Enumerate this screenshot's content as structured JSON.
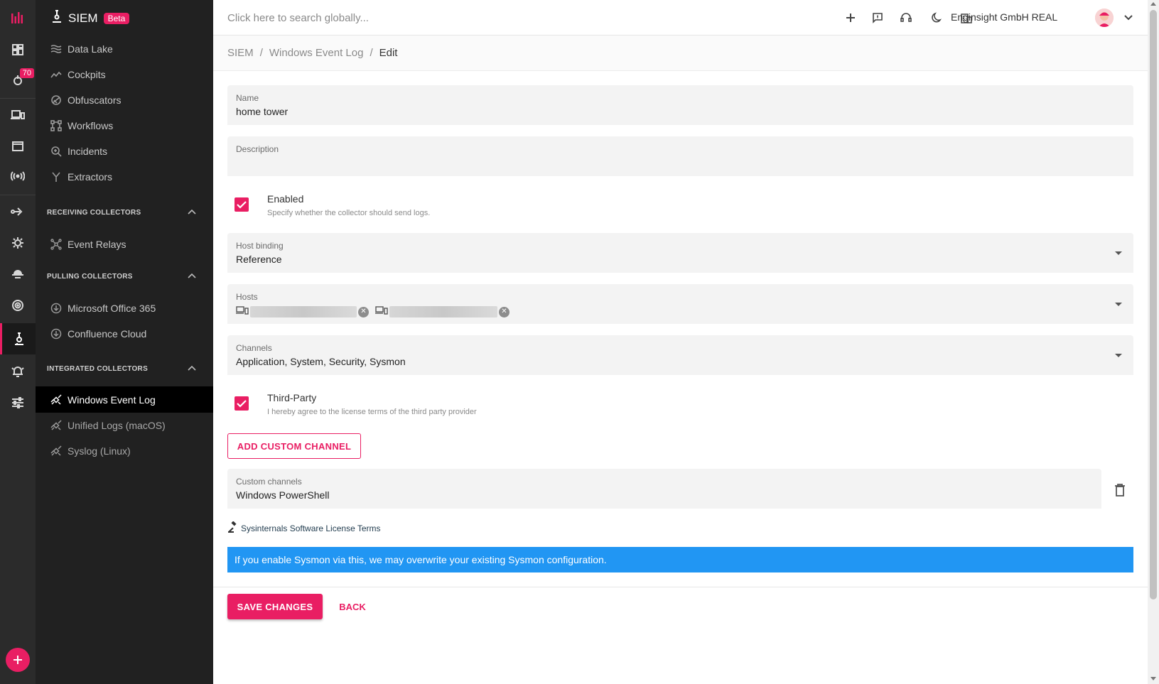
{
  "rail": {
    "notification_count": "70"
  },
  "sidebar": {
    "title": "SIEM",
    "badge": "Beta",
    "items": [
      {
        "label": "Data Lake",
        "icon": "data-lake-icon"
      },
      {
        "label": "Cockpits",
        "icon": "cockpits-icon"
      },
      {
        "label": "Obfuscators",
        "icon": "obfuscators-icon"
      },
      {
        "label": "Workflows",
        "icon": "workflows-icon"
      },
      {
        "label": "Incidents",
        "icon": "incidents-icon"
      },
      {
        "label": "Extractors",
        "icon": "extractors-icon"
      }
    ],
    "sections": [
      {
        "title": "RECEIVING COLLECTORS",
        "items": [
          {
            "label": "Event Relays"
          }
        ]
      },
      {
        "title": "PULLING COLLECTORS",
        "items": [
          {
            "label": "Microsoft Office 365"
          },
          {
            "label": "Confluence Cloud"
          }
        ]
      },
      {
        "title": "INTEGRATED COLLECTORS",
        "items": [
          {
            "label": "Windows Event Log"
          },
          {
            "label": "Unified Logs (macOS)"
          },
          {
            "label": "Syslog (Linux)"
          }
        ]
      }
    ]
  },
  "topbar": {
    "search_placeholder": "Click here to search globally...",
    "organization": "Enginsight GmbH REAL"
  },
  "breadcrumb": {
    "items": [
      "SIEM",
      "Windows Event Log",
      "Edit"
    ],
    "separator": "/"
  },
  "form": {
    "name": {
      "label": "Name",
      "value": "home tower"
    },
    "description": {
      "label": "Description",
      "value": ""
    },
    "enabled": {
      "label": "Enabled",
      "hint": "Specify whether the collector should send logs.",
      "checked": true
    },
    "host_binding": {
      "label": "Host binding",
      "value": "Reference"
    },
    "hosts": {
      "label": "Hosts"
    },
    "channels": {
      "label": "Channels",
      "value": "Application, System, Security, Sysmon"
    },
    "third_party": {
      "label": "Third-Party",
      "hint": "I hereby agree to the license terms of the third party provider",
      "checked": true
    },
    "add_channel_label": "ADD CUSTOM CHANNEL",
    "custom_channels": {
      "label": "Custom channels",
      "value": "Windows PowerShell"
    },
    "license_link": "Sysinternals Software License Terms",
    "info_message": "If you enable Sysmon via this, we may overwrite your existing Sysmon configuration.",
    "save_label": "SAVE CHANGES",
    "back_label": "BACK"
  },
  "colors": {
    "accent": "#e91e63",
    "info": "#2196f3",
    "sidebar_bg": "#212121",
    "rail_bg": "#2b2b2b"
  }
}
